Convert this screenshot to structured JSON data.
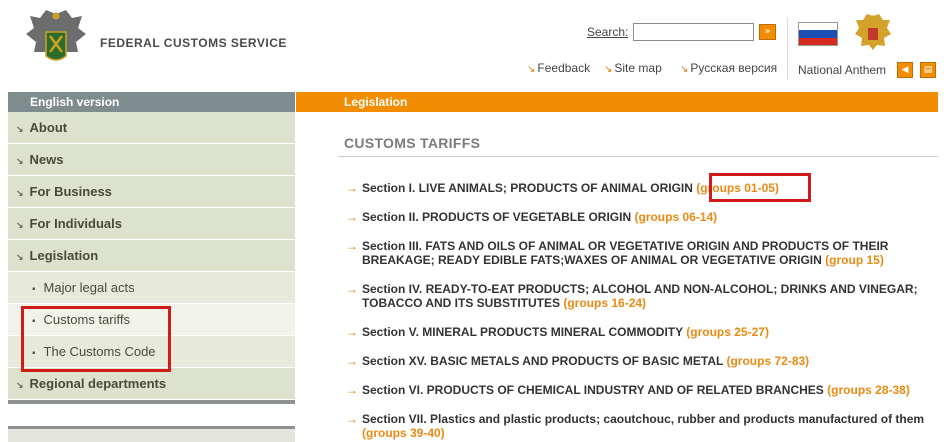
{
  "header": {
    "site_name": "FEDERAL CUSTOMS SERVICE",
    "search_label": "Search:",
    "search_value": "",
    "search_go": "»",
    "links": [
      {
        "label": "Feedback"
      },
      {
        "label": "Site map"
      },
      {
        "label": "Русская версия"
      }
    ],
    "anthem_label": "National Anthem",
    "play_icon": "◀",
    "text_icon": "▤",
    "flag_colors": [
      "#ffffff",
      "#1c4fb4",
      "#d52b1e"
    ]
  },
  "sidebar": {
    "header": "English version",
    "items": [
      {
        "label": "About",
        "level": 1
      },
      {
        "label": "News",
        "level": 1
      },
      {
        "label": "For Business",
        "level": 1
      },
      {
        "label": "For Individuals",
        "level": 1
      },
      {
        "label": "Legislation",
        "level": 1
      },
      {
        "label": "Major legal acts",
        "level": 2
      },
      {
        "label": "Customs tariffs",
        "level": 2
      },
      {
        "label": "The Customs Code",
        "level": 2
      },
      {
        "label": "Regional departments",
        "level": 1
      }
    ]
  },
  "main": {
    "header": "Legislation",
    "title": "CUSTOMS TARIFFS",
    "sections": [
      {
        "text": "Section I. LIVE ANIMALS; PRODUCTS OF ANIMAL ORIGIN",
        "groups": "(groups 01-05)"
      },
      {
        "text": "Section II. PRODUCTS OF VEGETABLE ORIGIN",
        "groups": "(groups 06-14)"
      },
      {
        "text": "Section III. FATS AND OILS OF ANIMAL OR VEGETATIVE ORIGIN AND PRODUCTS OF THEIR BREAKAGE; READY EDIBLE FATS;WAXES OF ANIMAL OR VEGETATIVE ORIGIN",
        "groups": "(group 15)"
      },
      {
        "text": "Section IV. READY-TO-EAT PRODUCTS; ALCOHOL AND NON-ALCOHOL; DRINKS AND VINEGAR; TOBACCO AND ITS SUBSTITUTES",
        "groups": "(groups 16-24)"
      },
      {
        "text": "Section V. MINERAL PRODUCTS MINERAL COMMODITY",
        "groups": "(groups 25-27)"
      },
      {
        "text": "Section XV. BASIC METALS AND PRODUCTS OF BASIC METAL",
        "groups": "(groups 72-83)"
      },
      {
        "text": "Section VI. PRODUCTS OF CHEMICAL INDUSTRY AND OF RELATED BRANCHES",
        "groups": "(groups 28-38)"
      },
      {
        "text": "Section VII. Plastics and plastic products; caoutchouc, rubber and products manufactured of them",
        "groups": "(groups 39-40)"
      }
    ]
  },
  "colors": {
    "accent": "#f28c00",
    "group_link": "#e88a13",
    "highlight": "#d11b1b",
    "nav_bg": "#dde2cc"
  }
}
